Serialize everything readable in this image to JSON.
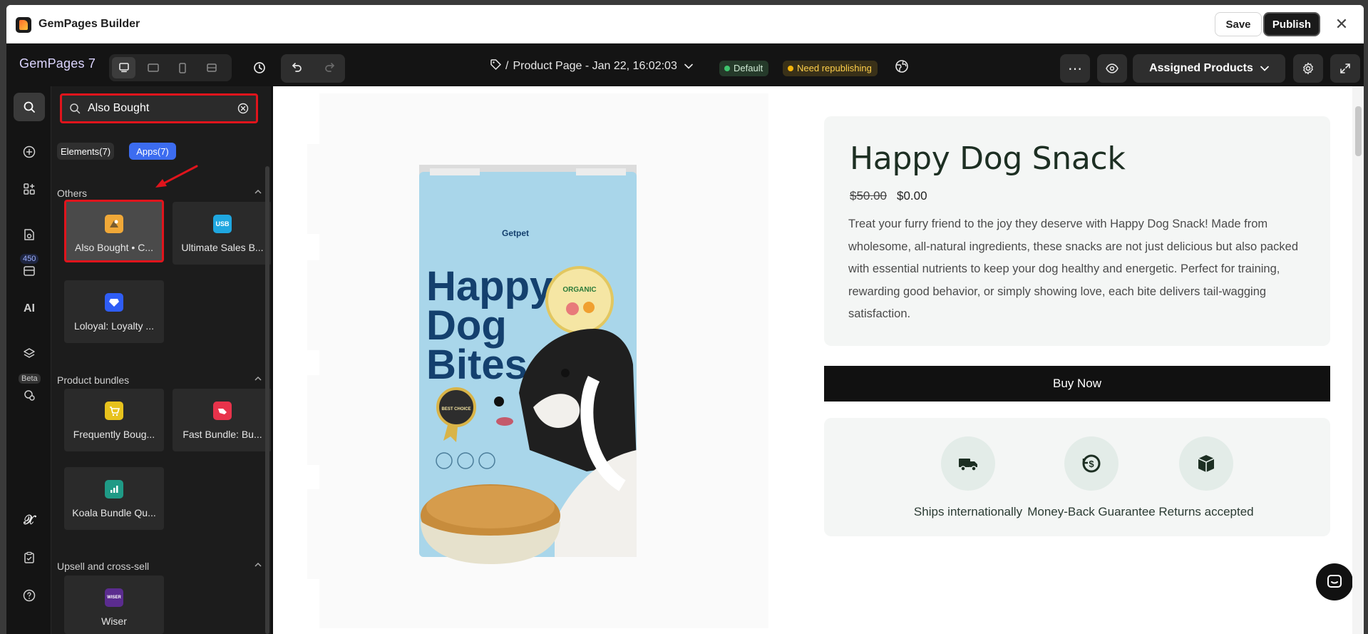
{
  "window": {
    "title": "GemPages Builder",
    "save_label": "Save",
    "publish_label": "Publish",
    "close_glyph": "✕"
  },
  "toolbar": {
    "brand": "GemPages 7",
    "page_prefix": "/",
    "page_name": "Product Page - Jan 22, 16:02:03",
    "status_default": "Default",
    "status_republish": "Need republishing",
    "assigned_label": "Assigned Products",
    "more_glyph": "⋯"
  },
  "rail": {
    "count_badge": "450",
    "beta_badge": "Beta"
  },
  "sidebar": {
    "search_value": "Also Bought",
    "chips": {
      "elements": "Elements(7)",
      "apps": "Apps(7)"
    },
    "sections": [
      {
        "title": "Others",
        "items": [
          {
            "label": "Also Bought • C...",
            "icon": "also-bought-icon",
            "color": "#f0a838"
          },
          {
            "label": "Ultimate Sales B...",
            "icon": "usb-icon",
            "color": "#1fa7e0"
          },
          {
            "label": "Loloyal: Loyalty ...",
            "icon": "loloyal-icon",
            "color": "#2f5df5"
          }
        ]
      },
      {
        "title": "Product bundles",
        "items": [
          {
            "label": "Frequently Boug...",
            "icon": "frequently-bought-icon",
            "color": "#e7c21d"
          },
          {
            "label": "Fast Bundle: Bu...",
            "icon": "fast-bundle-icon",
            "color": "#e8334b"
          },
          {
            "label": "Koala Bundle Qu...",
            "icon": "koala-bundle-icon",
            "color": "#1f9a86"
          }
        ]
      },
      {
        "title": "Upsell and cross-sell",
        "items": [
          {
            "label": "Wiser",
            "icon": "wiser-icon",
            "color": "#5b2c8f",
            "badge": "WISER"
          }
        ]
      }
    ]
  },
  "product": {
    "title": "Happy Dog Snack",
    "old_price": "$50.00",
    "price": "$0.00",
    "description": "Treat your furry friend to the joy they deserve with Happy Dog Snack! Made from wholesome, all-natural ingredients, these snacks are not just delicious but also packed with essential nutrients to keep your dog healthy and energetic. Perfect for training, rewarding good behavior, or simply showing love, each bite delivers tail-wagging satisfaction.",
    "buy_label": "Buy Now",
    "features": [
      {
        "label": "Ships internationally",
        "icon": "truck-icon"
      },
      {
        "label": "Money-Back Guarantee",
        "icon": "money-back-icon"
      },
      {
        "label": "Returns accepted",
        "icon": "box-icon"
      }
    ],
    "package_text": {
      "brand": "Getpet",
      "line1": "Happy",
      "line2": "Dog",
      "line3": "Bites",
      "organic": "ORGANIC",
      "best_choice": "BEST CHOICE"
    }
  },
  "colors": {
    "accent_blue": "#3c6cf0",
    "highlight_red": "#e0141c",
    "brand_purple": "#dcd5ff",
    "package_blue": "#a9d6ea"
  }
}
